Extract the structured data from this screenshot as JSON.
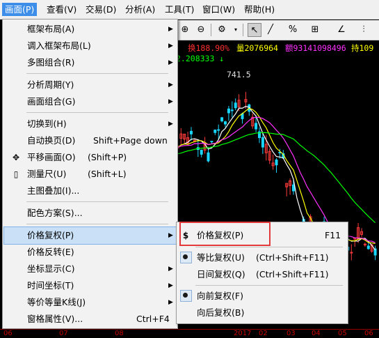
{
  "menubar": {
    "items": [
      {
        "label": "画面(P)",
        "active": true
      },
      {
        "label": "查看(V)"
      },
      {
        "label": "交易(D)"
      },
      {
        "label": "分析(A)"
      },
      {
        "label": "工具(T)"
      },
      {
        "label": "窗口(W)"
      },
      {
        "label": "帮助(H)"
      }
    ]
  },
  "chart": {
    "info_line": [
      "换188.90%",
      "量2076964",
      "额93141098496",
      "持109"
    ],
    "info_colors": [
      "#ff3030",
      "#ffff00",
      "#ff30ff",
      "#ffff00"
    ],
    "value_readout": "2.208333 ↓",
    "peak_label": "741.5",
    "xaxis_labels": [
      "06",
      "07",
      "08",
      "2017",
      "02",
      "03",
      "04",
      "05",
      "06"
    ]
  },
  "main_menu": {
    "items": [
      {
        "label": "框架布局(A)",
        "submenu": true
      },
      {
        "label": "调入框架布局(L)",
        "submenu": true
      },
      {
        "label": "多图组合(R)",
        "submenu": true
      },
      {
        "sep": true
      },
      {
        "label": "分析周期(Y)",
        "submenu": true
      },
      {
        "label": "画面组合(G)",
        "submenu": true
      },
      {
        "sep": true
      },
      {
        "label": "切换到(H)",
        "submenu": true
      },
      {
        "label": "自动换页(D)",
        "shortcut": "Shift+Page down"
      },
      {
        "label": "平移画面(O)",
        "shortcut": "(Shift+P)",
        "icon": "move-icon"
      },
      {
        "label": "测量尺(U)",
        "shortcut": "(Shift+L)",
        "icon": "ruler-icon"
      },
      {
        "label": "主图叠加(I)..."
      },
      {
        "sep": true
      },
      {
        "label": "配色方案(S)..."
      },
      {
        "sep": true
      },
      {
        "label": "价格复权(P)",
        "submenu": true,
        "highlighted": true
      },
      {
        "label": "价格反转(E)"
      },
      {
        "label": "坐标显示(C)",
        "submenu": true
      },
      {
        "label": "时间坐标(T)",
        "submenu": true
      },
      {
        "label": "等价等量K线(J)",
        "submenu": true
      },
      {
        "label": "窗格属性(V)...",
        "shortcut": "Ctrl+F4"
      }
    ]
  },
  "sub_menu": {
    "items": [
      {
        "label": "价格复权(P)",
        "shortcut": "F11",
        "icon": "dollar-icon"
      },
      {
        "sep": true
      },
      {
        "label": "等比复权(U)",
        "shortcut": "(Ctrl+Shift+F11)",
        "checked": true
      },
      {
        "label": "日间复权(Q)",
        "shortcut": "(Ctrl+Shift+F11)"
      },
      {
        "sep": true
      },
      {
        "label": "向前复权(F)",
        "checked": true
      },
      {
        "label": "向后复权(B)"
      }
    ]
  }
}
